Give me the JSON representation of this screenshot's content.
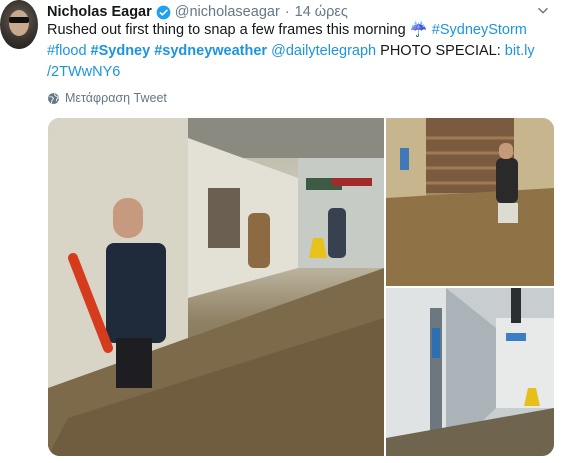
{
  "author": {
    "name": "Nicholas Eagar",
    "handle": "@nicholaseagar",
    "separator": "·",
    "time": "14 ώρες"
  },
  "tweet": {
    "line1_text": "Rushed out first thing to snap a few frames this morning ",
    "umbrella_emoji": "☔",
    "hashtag_storm": "#SydneyStorm",
    "hashtag_flood": "#flood",
    "hashtag_sydney": "#Sydney",
    "hashtag_weather": "#sydneyweather",
    "mention": "@dailytelegraph",
    "photo_special": "PHOTO SPECIAL:",
    "link_part1": "bit.ly",
    "link_part2": "/2TWwNY6"
  },
  "translate_label": "Μετάφραση Tweet",
  "colors": {
    "link": "#1b95e0",
    "muted": "#657786",
    "text": "#14171a"
  },
  "icons": {
    "verified": "verified-badge-icon",
    "caret": "chevron-down-icon",
    "globe": "globe-icon"
  }
}
